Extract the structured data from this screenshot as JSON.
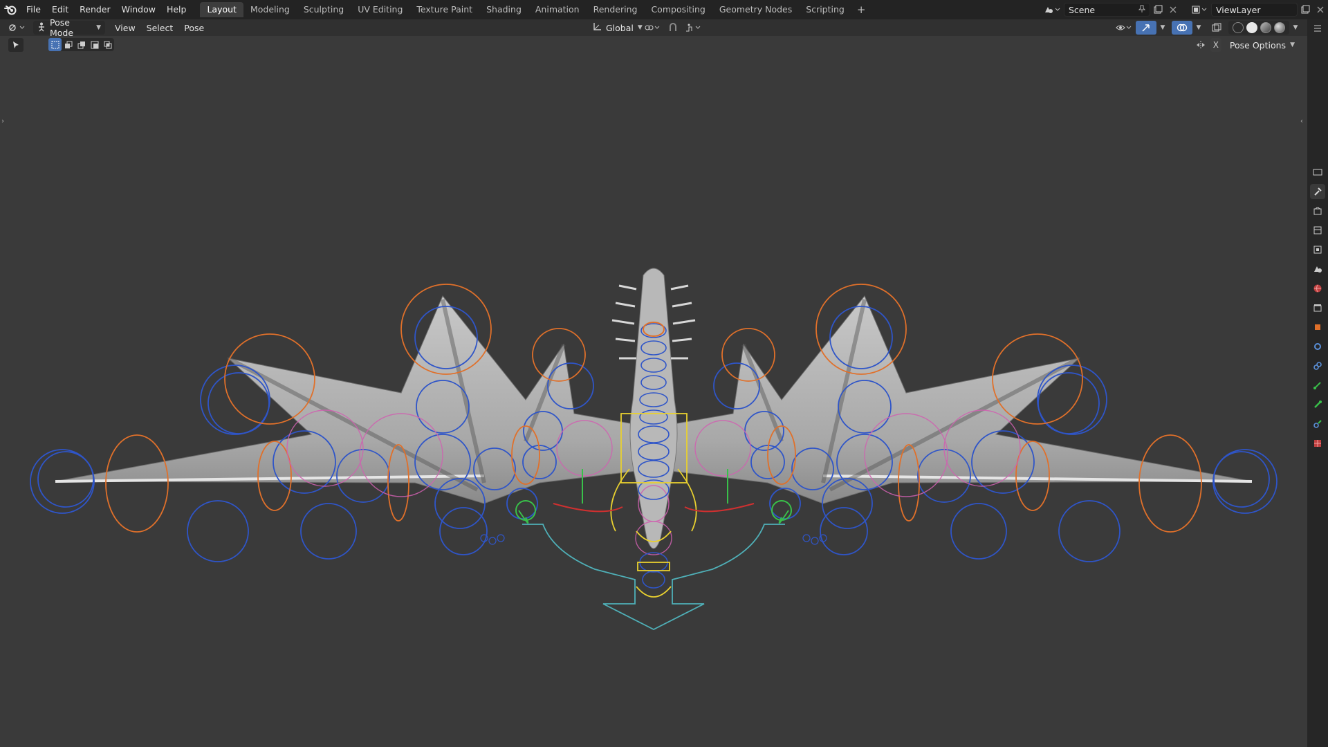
{
  "menu": [
    "File",
    "Edit",
    "Render",
    "Window",
    "Help"
  ],
  "workspaces": [
    "Layout",
    "Modeling",
    "Sculpting",
    "UV Editing",
    "Texture Paint",
    "Shading",
    "Animation",
    "Rendering",
    "Compositing",
    "Geometry Nodes",
    "Scripting"
  ],
  "active_workspace": "Layout",
  "add_tab_symbol": "+",
  "scene": {
    "value": "Scene"
  },
  "view_layer": {
    "value": "ViewLayer"
  },
  "header": {
    "mode": "Pose Mode",
    "menus": [
      "View",
      "Select",
      "Pose"
    ],
    "transform_orientation": "Global"
  },
  "tool_header": {
    "pose_options": "Pose Options",
    "x_mirror": "X"
  },
  "colors": {
    "topbar": "#232323",
    "header": "#303030",
    "viewport": "#3a3a3a",
    "accent": "#4772b3",
    "bone_blue": "#2f55c8",
    "bone_orange": "#e0702a",
    "bone_pink": "#d060b0",
    "bone_yellow": "#e8d030",
    "bone_cyan": "#4fb0b8",
    "bone_green": "#39c04a",
    "bone_red": "#d03030"
  },
  "viewport": {
    "subject": "dragon-armature",
    "icons": {
      "mode": "pose-mode-icon",
      "orientation": "orientation-icon",
      "snap": "snap-icon",
      "proportional": "proportional-edit-icon"
    }
  }
}
